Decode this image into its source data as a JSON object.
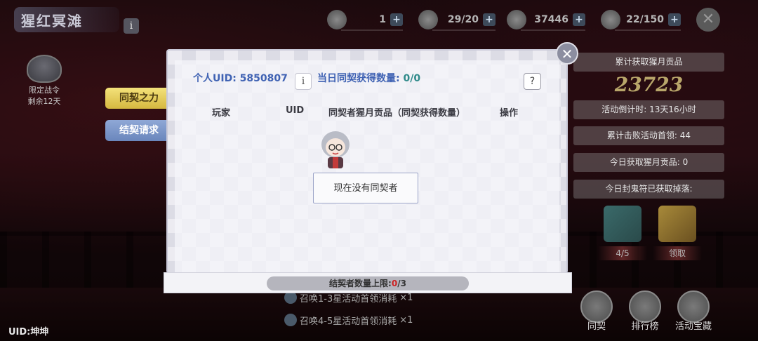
{
  "event": {
    "title": "猩红冥滩",
    "info_icon": "i"
  },
  "battle_pass": {
    "label": "限定战令",
    "remaining": "剩余12天"
  },
  "resources": [
    {
      "icon": "scroll-icon",
      "value": "1"
    },
    {
      "icon": "stamina-icon",
      "value": "29/20"
    },
    {
      "icon": "paper-icon",
      "value": "37446"
    },
    {
      "icon": "feather-icon",
      "value": "22/150"
    }
  ],
  "plus_label": "+",
  "tabs": {
    "active": "同契之力",
    "inactive": "结契请求"
  },
  "stats": {
    "total_label": "累计获取猩月贡品",
    "total_value": "23723",
    "countdown": "活动倒计时: 13天16小时",
    "defeated": "累计击败活动首领: 44",
    "today": "今日获取猩月贡品: 0",
    "drops": "今日封鬼符已获取掉落:"
  },
  "loot": [
    {
      "tag": "4/5"
    },
    {
      "tag": "领取"
    }
  ],
  "bottom_icons": [
    "同契",
    "排行榜",
    "活动宝藏"
  ],
  "consume": [
    {
      "text": "召唤1-3星活动首领消耗",
      "qty": "×1"
    },
    {
      "text": "召唤4-5星活动首领消耗",
      "qty": "×1"
    }
  ],
  "uid_bottom": "UID:坤坤",
  "modal": {
    "uid_label": "个人UID: 5850807",
    "daily_label": "当日同契获得数量:",
    "daily_value": "0/0",
    "help": "?",
    "info": "i",
    "close": "✕",
    "columns": [
      "玩家",
      "UID",
      "同契者猩月贡品（同契获得数量）",
      "操作"
    ],
    "empty_text": "现在没有同契者",
    "limit_prefix": "结契者数量上限:",
    "limit_current": "0",
    "limit_max": "/3"
  },
  "colors": {
    "accent_blue": "#3f62b3",
    "tab_gold": "#e6cc55",
    "stat_gold": "#b8a66a"
  }
}
